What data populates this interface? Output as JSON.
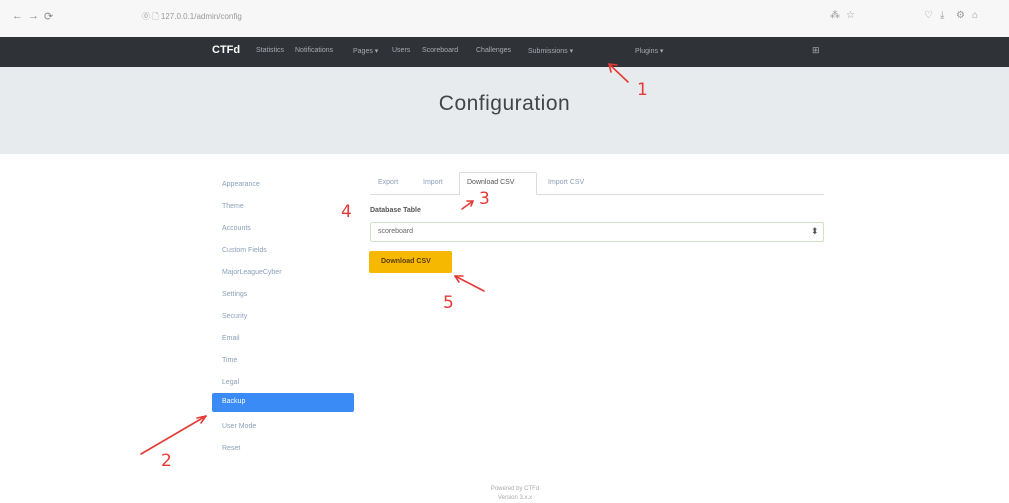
{
  "browser": {
    "back": "←",
    "forward": "→",
    "reload": "⟳",
    "url": "⓪ 🗋 127.0.0.1/admin/config",
    "tools_left": [
      "⁂",
      "☆"
    ],
    "tools_right": [
      "♡",
      "⤓",
      "⚙",
      "⌂"
    ]
  },
  "navbar": {
    "brand": "CTFd",
    "links": [
      "Statistics",
      "Notifications",
      "Pages ▾",
      "Users",
      "Scoreboard",
      "Challenges",
      "Submissions ▾",
      "Plugins ▾"
    ],
    "right_icon": "⊞"
  },
  "page": {
    "title": "Configuration"
  },
  "sidebar": {
    "items": [
      "Appearance",
      "Theme",
      "Accounts",
      "Custom Fields",
      "MajorLeagueCyber",
      "Settings",
      "Security",
      "Email",
      "Time",
      "Legal",
      "Backup",
      "User Mode",
      "Reset"
    ],
    "active": "Backup"
  },
  "tabs": {
    "items": [
      "Export",
      "Import",
      "Download CSV",
      "Import CSV"
    ],
    "active": "Download CSV"
  },
  "form": {
    "label": "Database Table",
    "select_value": "scoreboard",
    "caret": "⬍",
    "button": "Download CSV"
  },
  "footer": {
    "line1": "Powered by CTFd",
    "line2": "Version 3.x.x"
  },
  "annotations": [
    "1",
    "2",
    "3",
    "4",
    "5"
  ],
  "colors": {
    "navbar": "#2f3237",
    "active_sidebar": "#3a8bf5",
    "download_button": "#f6b800",
    "annotation": "#e53935"
  }
}
